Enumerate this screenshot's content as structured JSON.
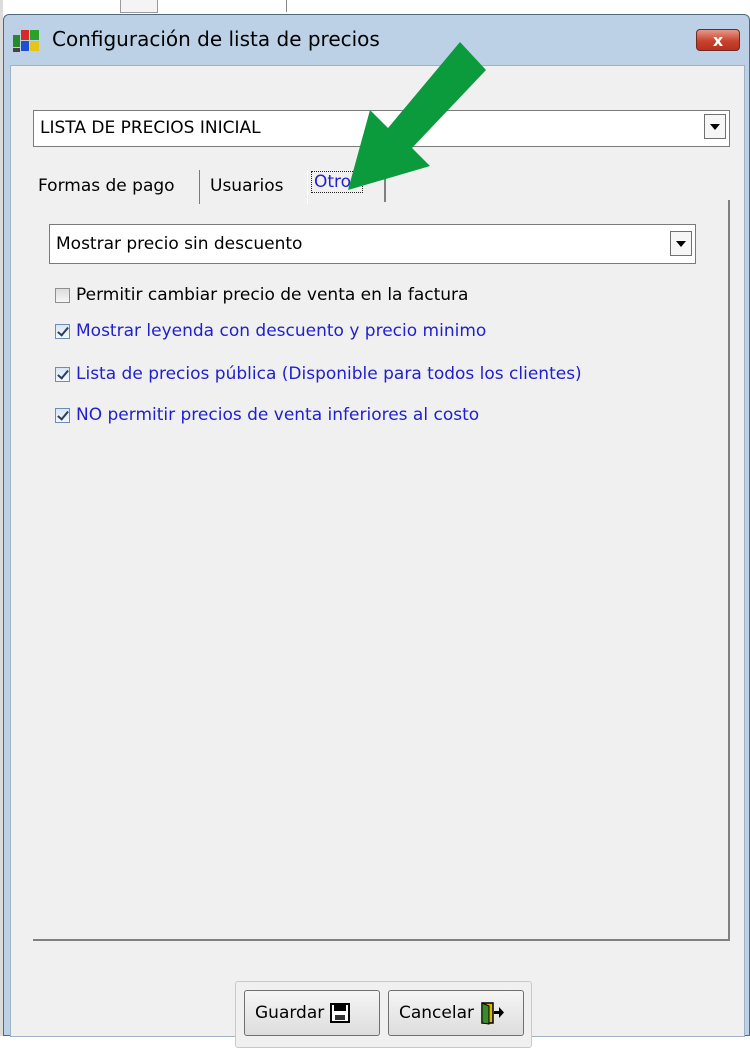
{
  "window": {
    "title": "Configuración de lista de precios",
    "close_label": "x"
  },
  "price_list_select": {
    "value": "LISTA DE PRECIOS INICIAL"
  },
  "tabs": [
    {
      "label": "Formas de pago",
      "active": false
    },
    {
      "label": "Usuarios",
      "active": false
    },
    {
      "label": "Otros",
      "active": true
    }
  ],
  "otros": {
    "price_mode_select": {
      "value": "Mostrar precio sin descuento"
    },
    "options": [
      {
        "label": "Permitir cambiar precio de venta en la factura",
        "checked": false
      },
      {
        "label": "Mostrar leyenda con descuento y precio minimo",
        "checked": true
      },
      {
        "label": "Lista de precios pública (Disponible para todos los clientes)",
        "checked": true
      },
      {
        "label": "NO permitir precios de venta inferiores al costo",
        "checked": true
      }
    ]
  },
  "buttons": {
    "save_label": "Guardar",
    "cancel_label": "Cancelar"
  },
  "icons": {
    "app": "app-window-icon",
    "save": "floppy-disk-icon",
    "cancel": "exit-door-icon",
    "annotation": "green-arrow-icon"
  },
  "colors": {
    "titlebar": "#bcd1e6",
    "close": "#c8432e",
    "checked_label": "#1f1fd0",
    "annotation_arrow": "#0b9a3c"
  }
}
